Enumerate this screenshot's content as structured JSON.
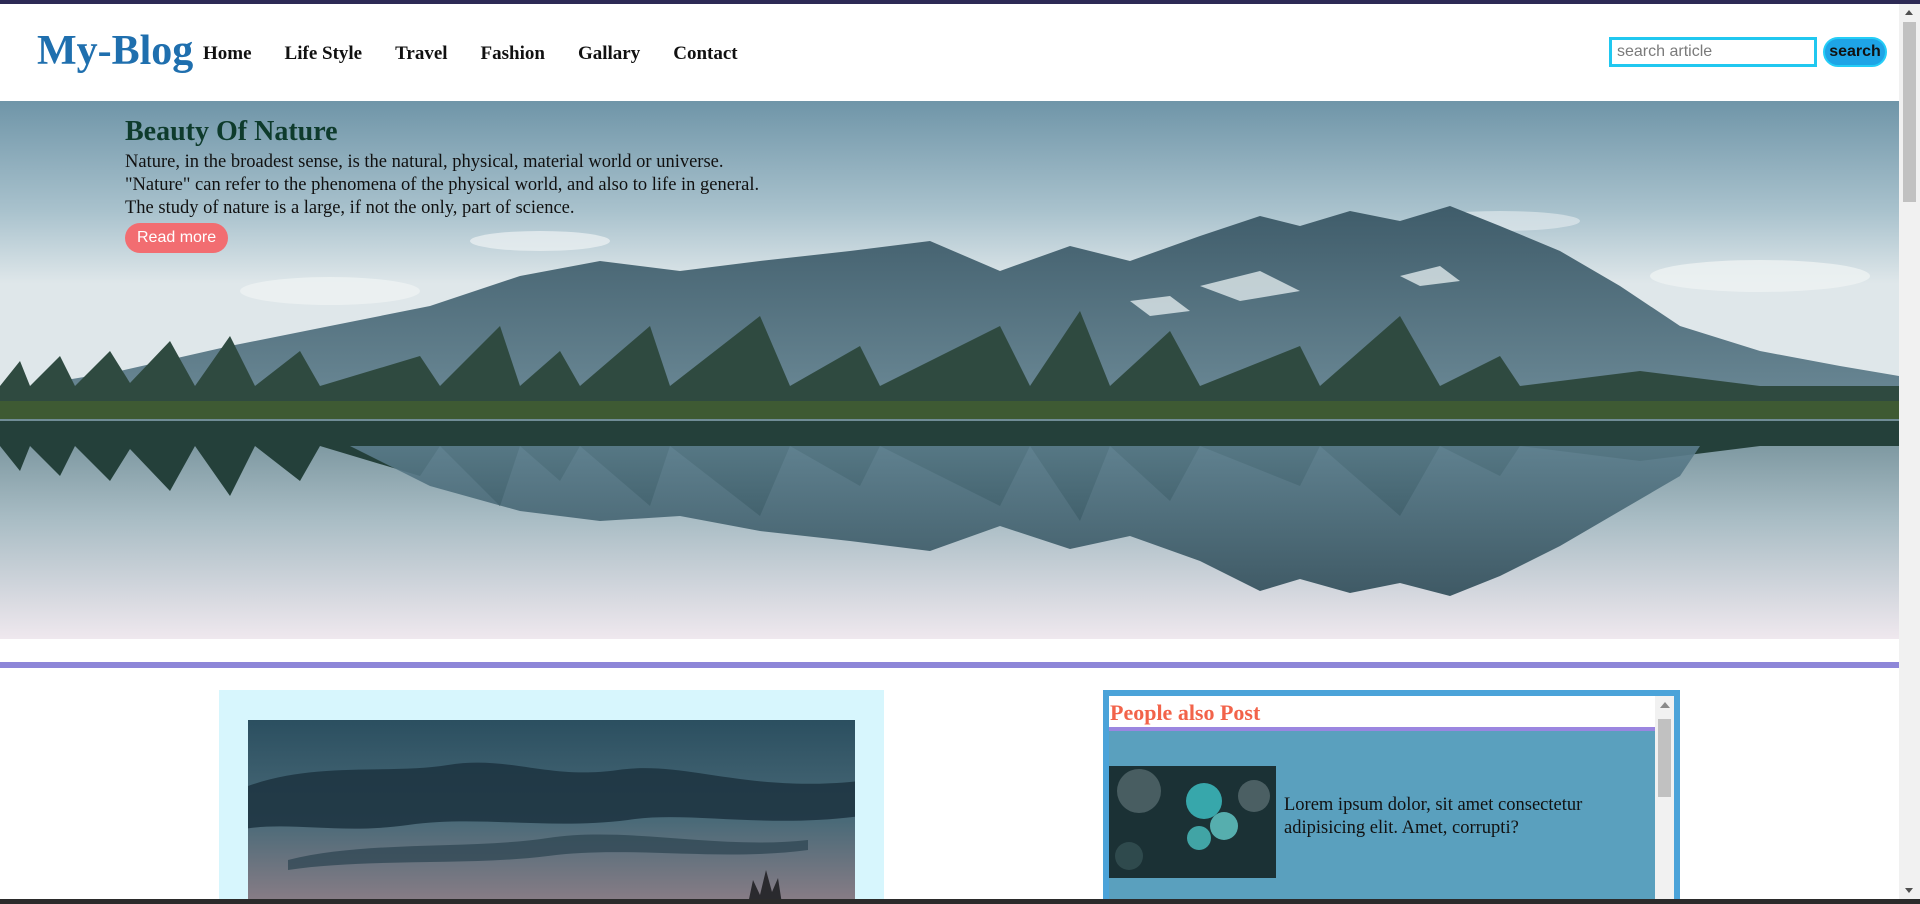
{
  "header": {
    "logo": "My-Blog",
    "nav": [
      "Home",
      "Life Style",
      "Travel",
      "Fashion",
      "Gallary",
      "Contact"
    ],
    "search_placeholder": "search article",
    "search_value": "",
    "search_button": "search"
  },
  "hero": {
    "title": "Beauty Of Nature",
    "lines": [
      "Nature, in the broadest sense, is the natural, physical, material world or universe.",
      "\"Nature\" can refer to the phenomena of the physical world, and also to life in general.",
      "The study of nature is a large, if not the only, part of science."
    ],
    "button": "Read more"
  },
  "sidebar": {
    "title": "People also Post",
    "posts": [
      {
        "text": "Lorem ipsum dolor, sit amet consectetur adipisicing elit. Amet, corrupti?"
      }
    ]
  },
  "colors": {
    "logo": "#1f6fae",
    "search_border": "#20c8f0",
    "search_button": "#1ea4e6",
    "read_more": "#f26d71",
    "divider": "#8d86d8",
    "post_card_bg": "#d7f6fd",
    "sidebar_frame": "#4ba3d9",
    "sidebar_bg": "#5aa0be",
    "sidebar_title": "#f2634a"
  }
}
